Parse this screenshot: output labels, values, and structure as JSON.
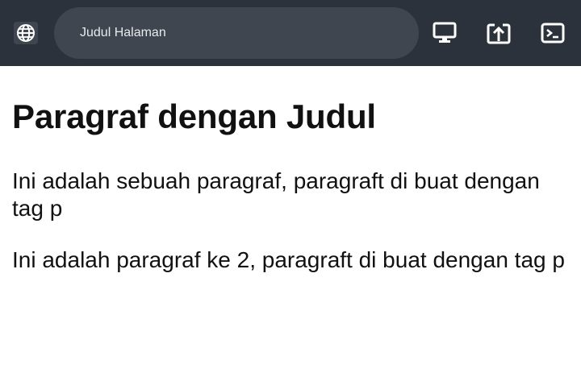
{
  "toolbar": {
    "address_text": "Judul Halaman",
    "icons": {
      "globe": "globe-icon",
      "desktop": "desktop-icon",
      "open_external": "open-in-new-icon",
      "console": "terminal-icon"
    },
    "background": "#2b323b",
    "field_background": "#3f4650"
  },
  "page": {
    "heading": "Paragraf dengan Judul",
    "paragraphs": [
      "Ini adalah sebuah paragraf, paragraft di buat dengan tag p",
      "Ini adalah paragraf ke 2, paragraft di buat dengan tag p"
    ]
  }
}
